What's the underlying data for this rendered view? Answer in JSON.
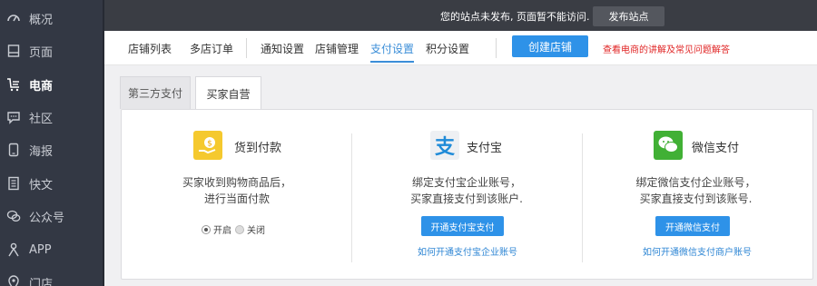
{
  "sidebar": {
    "items": [
      {
        "label": "概况",
        "icon": "gauge-icon"
      },
      {
        "label": "页面",
        "icon": "page-icon"
      },
      {
        "label": "电商",
        "icon": "shop-list-icon"
      },
      {
        "label": "社区",
        "icon": "chat-icon"
      },
      {
        "label": "海报",
        "icon": "phone-icon"
      },
      {
        "label": "快文",
        "icon": "document-icon"
      },
      {
        "label": "公众号",
        "icon": "wechat-icon"
      },
      {
        "label": "APP",
        "icon": "person-icon"
      },
      {
        "label": "门店",
        "icon": "location-icon"
      }
    ],
    "active_label": "电商"
  },
  "topbar": {
    "notice": "您的站点未发布, 页面暂不能访问.",
    "publish_label": "发布站点"
  },
  "nav": {
    "links": [
      "店铺列表",
      "多店订单",
      "通知设置",
      "店铺管理",
      "支付设置",
      "积分设置"
    ],
    "active": "支付设置",
    "create_label": "创建店铺",
    "help_label": "查看电商的讲解及常见问题解答"
  },
  "tabs": {
    "third_party": "第三方支付",
    "merchant": "买家自营"
  },
  "payments": {
    "cod": {
      "title": "货到付款",
      "desc_line1": "买家收到购物商品后，",
      "desc_line2": "进行当面付款",
      "on_label": "开启",
      "off_label": "关闭",
      "state": "开启"
    },
    "alipay": {
      "title": "支付宝",
      "desc_line1": "绑定支付宝企业账号，",
      "desc_line2": "买家直接支付到该账户.",
      "button_label": "开通支付宝支付",
      "link_label": "如何开通支付宝企业账号"
    },
    "wechat": {
      "title": "微信支付",
      "desc_line1": "绑定微信支付企业账号，",
      "desc_line2": "买家直接支付到该账号.",
      "button_label": "开通微信支付",
      "link_label": "如何开通微信支付商户账号"
    }
  },
  "colors": {
    "sidebar_bg": "#333844",
    "accent_blue": "#2e92e8",
    "alert_red": "#e02424",
    "alipay_blue": "#1f8bd8",
    "wechat_green": "#41b035",
    "cod_yellow": "#f5c92e"
  }
}
